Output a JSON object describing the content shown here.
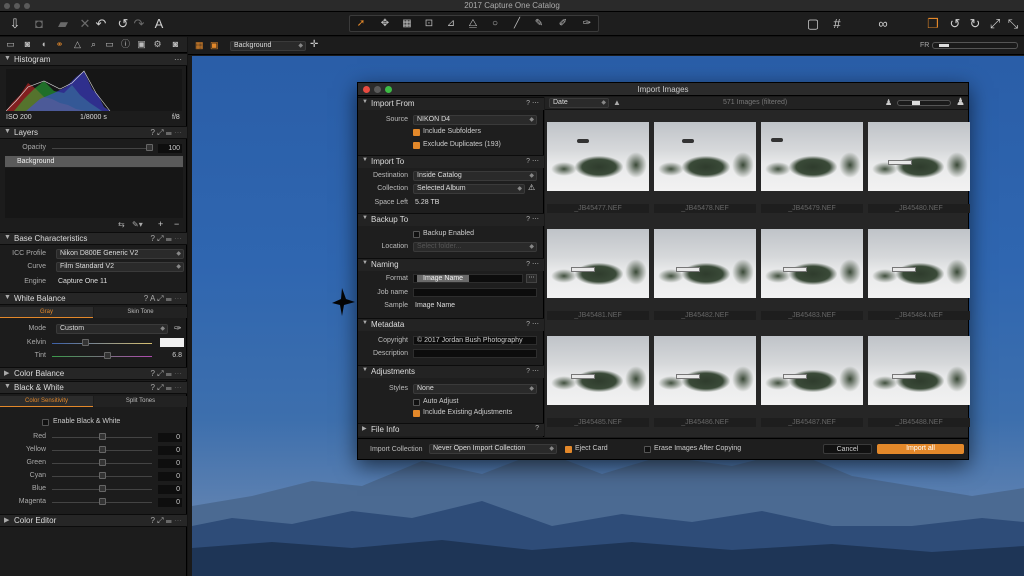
{
  "window": {
    "title": "2017 Capture One Catalog"
  },
  "toolbar": {
    "left_icons": [
      "import-icon",
      "camera-icon",
      "folder-export-icon",
      "close-icon",
      "undo-icon",
      "undo-alt-icon",
      "redo-icon",
      "text-tool-icon"
    ],
    "cursor_tools": [
      "pointer-icon",
      "pan-icon",
      "loupe-icon",
      "crop-icon",
      "straighten-icon",
      "keystone-icon",
      "spot-icon",
      "picker-icon",
      "brush-icon",
      "eraser-icon",
      "color-picker-icon"
    ],
    "right_icons": [
      "histogram-icon",
      "grid-icon",
      "glasses-icon",
      "layers-icon",
      "rotate-left-icon",
      "rotate-right-icon",
      "expand-icon",
      "shrink-icon"
    ]
  },
  "left_panel": {
    "histogram": {
      "title": "Histogram",
      "iso": "ISO 200",
      "shutter": "1/8000 s",
      "aperture": "f/8"
    },
    "layers": {
      "title": "Layers",
      "opacity_label": "Opacity",
      "opacity_value": "100",
      "layer_name": "Background"
    },
    "base": {
      "title": "Base Characteristics",
      "icc_label": "ICC Profile",
      "icc_value": "Nikon D800E Generic V2",
      "curve_label": "Curve",
      "curve_value": "Film Standard V2",
      "engine_label": "Engine",
      "engine_value": "Capture One 11"
    },
    "white_balance": {
      "title": "White Balance",
      "tab_gray": "Gray",
      "tab_skin": "Skin Tone",
      "mode_label": "Mode",
      "mode_value": "Custom",
      "kelvin_label": "Kelvin",
      "tint_label": "Tint",
      "tint_value": "6.8"
    },
    "color_balance": {
      "title": "Color Balance"
    },
    "bw": {
      "title": "Black & White",
      "tab_sensitivity": "Color Sensitivity",
      "tab_split": "Split Tones",
      "enable_label": "Enable Black & White",
      "rows": [
        {
          "label": "Red",
          "value": "0"
        },
        {
          "label": "Yellow",
          "value": "0"
        },
        {
          "label": "Green",
          "value": "0"
        },
        {
          "label": "Cyan",
          "value": "0"
        },
        {
          "label": "Blue",
          "value": "0"
        },
        {
          "label": "Magenta",
          "value": "0"
        }
      ]
    },
    "color_editor": {
      "title": "Color Editor"
    }
  },
  "viewer": {
    "layer_select": "Background",
    "right_label": "FR"
  },
  "dialog": {
    "title": "Import Images",
    "import_from": {
      "title": "Import From",
      "source_label": "Source",
      "source_value": "NIKON D4",
      "include_subfolders": "Include Subfolders",
      "exclude_duplicates": "Exclude Duplicates (193)"
    },
    "import_to": {
      "title": "Import To",
      "destination_label": "Destination",
      "destination_value": "Inside Catalog",
      "collection_label": "Collection",
      "collection_value": "Selected Album",
      "space_label": "Space Left",
      "space_value": "5.28 TB"
    },
    "backup": {
      "title": "Backup To",
      "enabled_label": "Backup Enabled",
      "location_label": "Location",
      "location_placeholder": "Select folder..."
    },
    "naming": {
      "title": "Naming",
      "format_label": "Format",
      "format_value": "Image Name",
      "job_label": "Job name",
      "sample_label": "Sample",
      "sample_value": "Image Name"
    },
    "metadata": {
      "title": "Metadata",
      "copyright_label": "Copyright",
      "copyright_value": "© 2017 Jordan Bush Photography",
      "description_label": "Description"
    },
    "adjustments": {
      "title": "Adjustments",
      "styles_label": "Styles",
      "styles_value": "None",
      "auto_adjust": "Auto Adjust",
      "include_existing": "Include Existing Adjustments"
    },
    "file_info": {
      "title": "File Info"
    },
    "grid": {
      "sort_value": "Date",
      "count_label": "571 Images (filtered)",
      "thumbnails": [
        "_JB45477.NEF",
        "_JB45478.NEF",
        "_JB45479.NEF",
        "_JB45480.NEF",
        "_JB45481.NEF",
        "_JB45482.NEF",
        "_JB45483.NEF",
        "_JB45484.NEF",
        "_JB45485.NEF",
        "_JB45486.NEF",
        "_JB45487.NEF",
        "_JB45488.NEF"
      ]
    },
    "bottom": {
      "collection_label": "Import Collection",
      "collection_value": "Never Open Import Collection",
      "eject_label": "Eject Card",
      "erase_label": "Erase Images After Copying",
      "cancel_label": "Cancel",
      "import_label": "Import all"
    }
  },
  "colors": {
    "accent": "#e3882a",
    "sky": "#2f66b0"
  }
}
